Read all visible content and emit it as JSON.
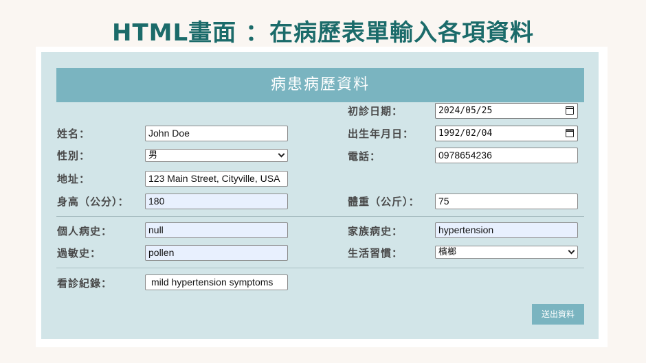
{
  "page_title": "HTML畫面 ：在病歷表單輸入各項資料",
  "form": {
    "header": "病患病歷資料",
    "fields": {
      "visit_date": {
        "label": "初診日期：",
        "value": "2024/05/25"
      },
      "name": {
        "label": "姓名：",
        "value": "John Doe"
      },
      "birth_date": {
        "label": "出生年月日：",
        "value": "1992/02/04"
      },
      "gender": {
        "label": "性別：",
        "value": "男"
      },
      "phone": {
        "label": "電話：",
        "value": "0978654236"
      },
      "address": {
        "label": "地址：",
        "value": "123 Main Street, Cityville, USA"
      },
      "height": {
        "label": "身高（公分）：",
        "value": "180"
      },
      "weight": {
        "label": "體重（公斤）：",
        "value": "75"
      },
      "personal_history": {
        "label": "個人病史：",
        "value": "null"
      },
      "family_history": {
        "label": "家族病史：",
        "value": "hypertension"
      },
      "allergy_history": {
        "label": "過敏史：",
        "value": "pollen"
      },
      "lifestyle": {
        "label": "生活習慣：",
        "value": "檳榔"
      },
      "visit_record": {
        "label": "看診紀錄：",
        "value": "mild hypertension symptoms"
      }
    },
    "submit_label": "送出資料"
  },
  "icons": {
    "date_picker": "calendar-icon",
    "dropdown": "chevron-down-icon"
  },
  "colors": {
    "title": "#1b6b6a",
    "header_bg": "#7ab4c0",
    "panel_bg": "#d2e5e8",
    "autofill_bg": "#e8f0fe"
  }
}
